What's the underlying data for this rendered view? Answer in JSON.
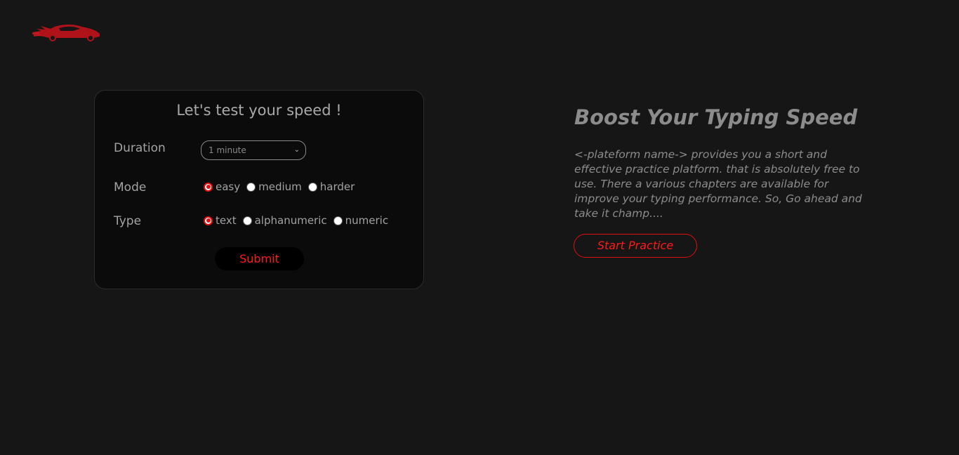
{
  "brand": {
    "logo_icon": "race-car-logo-icon",
    "accent": "#e01010"
  },
  "form": {
    "title": "Let's test your speed !",
    "duration": {
      "label": "Duration",
      "selected": "1 minute"
    },
    "mode": {
      "label": "Mode",
      "options": [
        {
          "label": "easy",
          "checked": true
        },
        {
          "label": "medium",
          "checked": false
        },
        {
          "label": "harder",
          "checked": false
        }
      ]
    },
    "type": {
      "label": "Type",
      "options": [
        {
          "label": "text",
          "checked": true
        },
        {
          "label": "alphanumeric",
          "checked": false
        },
        {
          "label": "numeric",
          "checked": false
        }
      ]
    },
    "submit_label": "Submit"
  },
  "hero": {
    "title": "Boost Your Typing Speed",
    "description": "<-plateform name-> provides you a short and effective practice platform. that is absolutely free to use. There a various chapters are available for improve your typing performance. So, Go ahead and take it champ....",
    "cta_label": "Start Practice"
  },
  "colors": {
    "background": "#161616",
    "card": "#0b0b0b",
    "text_muted": "#a3a3a3",
    "accent": "#ff1a1a"
  }
}
